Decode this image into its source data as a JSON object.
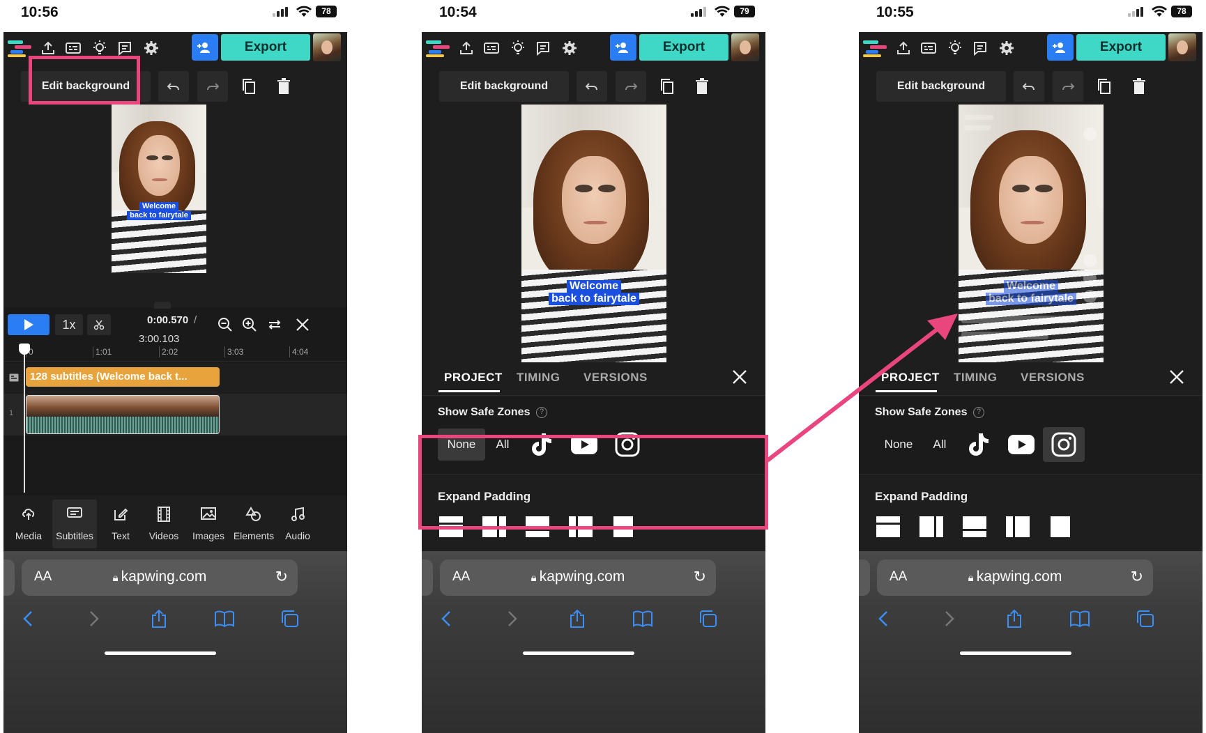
{
  "phones": [
    {
      "time": "10:56",
      "battery": "78",
      "app": {
        "export_label": "Export",
        "edit_background_label": "Edit background",
        "caption_line1": "Welcome",
        "caption_line2": "back to fairytale"
      },
      "timeline": {
        "current_time": "0:00.570",
        "separator": "/",
        "total_time": "3:00.103",
        "speed_label": "1x",
        "ruler_ticks": [
          "0",
          "1:01",
          "2:02",
          "3:03",
          "4:04"
        ],
        "subtitle_track_label": "128 subtitles (Welcome back t...",
        "row_number": "1"
      },
      "bottom_tabs": [
        "Media",
        "Subtitles",
        "Text",
        "Videos",
        "Images",
        "Elements",
        "Audio"
      ],
      "active_tab": "Subtitles",
      "url": "kapwing.com",
      "aa_label": "AA"
    },
    {
      "time": "10:54",
      "battery": "79",
      "app": {
        "export_label": "Export",
        "edit_background_label": "Edit background",
        "caption_line1": "Welcome",
        "caption_line2": "back to fairytale"
      },
      "panel": {
        "tabs": [
          "PROJECT",
          "TIMING",
          "VERSIONS"
        ],
        "active_tab": "PROJECT",
        "safe_zones_title": "Show Safe Zones",
        "help_symbol": "?",
        "safe_zone_options": [
          "None",
          "All"
        ],
        "selected_option": "None",
        "expand_padding_title": "Expand Padding"
      },
      "url": "kapwing.com",
      "aa_label": "AA"
    },
    {
      "time": "10:55",
      "battery": "78",
      "app": {
        "export_label": "Export",
        "edit_background_label": "Edit background",
        "caption_line1": "Welcome",
        "caption_line2": "back to fairytale"
      },
      "panel": {
        "tabs": [
          "PROJECT",
          "TIMING",
          "VERSIONS"
        ],
        "active_tab": "PROJECT",
        "safe_zones_title": "Show Safe Zones",
        "help_symbol": "?",
        "safe_zone_options": [
          "None",
          "All"
        ],
        "selected_option": "instagram-icon",
        "expand_padding_title": "Expand Padding"
      },
      "url": "kapwing.com",
      "aa_label": "AA"
    }
  ],
  "colors": {
    "highlight": "#e8467c",
    "export": "#3fd8c7",
    "accent_blue": "#2a7df2",
    "caption_bg": "#1a4fe0",
    "subtitle_track": "#e8a33c",
    "app_bg": "#1e1e1e"
  },
  "icons": [
    "upload-icon",
    "subtitle-icon",
    "lightbulb-icon",
    "comment-icon",
    "gear-icon",
    "add-user-icon",
    "undo-icon",
    "redo-icon",
    "duplicate-icon",
    "trash-icon",
    "scissors-icon",
    "zoom-out-icon",
    "zoom-in-icon",
    "swap-icon",
    "close-icon",
    "tiktok-icon",
    "youtube-icon",
    "instagram-icon",
    "lock-icon",
    "reload-icon",
    "back-icon",
    "forward-icon",
    "share-icon",
    "bookmarks-icon",
    "tabs-icon"
  ]
}
